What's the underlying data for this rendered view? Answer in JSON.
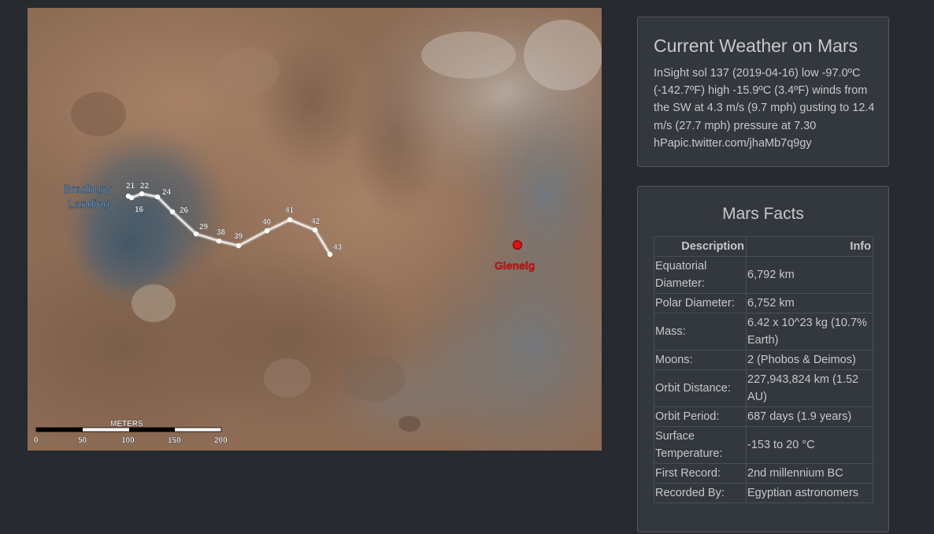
{
  "map": {
    "label_bradbury_1": "Bradbury",
    "label_bradbury_2": "Landing",
    "label_glenelg": "Glenelg",
    "scale_title": "METERS",
    "scale_ticks": [
      "0",
      "50",
      "100",
      "150",
      "200"
    ],
    "waypoints": [
      "21",
      "22",
      "16",
      "24",
      "26",
      "29",
      "38",
      "39",
      "40",
      "41",
      "42",
      "43"
    ]
  },
  "weather": {
    "title": "Current Weather on Mars",
    "text": "InSight sol 137 (2019-04-16) low -97.0ºC (-142.7ºF) high -15.9ºC (3.4ºF) winds from the SW at 4.3 m/s (9.7 mph) gusting to 12.4 m/s (27.7 mph) pressure at 7.30 hPapic.twitter.com/jhaMb7q9gy"
  },
  "facts": {
    "title": "Mars Facts",
    "headers": [
      "Description",
      "Info"
    ],
    "rows": [
      [
        "Equatorial Diameter:",
        "6,792 km"
      ],
      [
        "Polar Diameter:",
        "6,752 km"
      ],
      [
        "Mass:",
        "6.42 x 10^23 kg (10.7% Earth)"
      ],
      [
        "Moons:",
        "2 (Phobos & Deimos)"
      ],
      [
        "Orbit Distance:",
        "227,943,824 km (1.52 AU)"
      ],
      [
        "Orbit Period:",
        "687 days (1.9 years)"
      ],
      [
        "Surface Temperature:",
        "-153 to 20 °C"
      ],
      [
        "First Record:",
        "2nd millennium BC"
      ],
      [
        "Recorded By:",
        "Egyptian astronomers"
      ]
    ]
  },
  "colors": {
    "page_bg": "#272b30",
    "card_bg": "#32383e",
    "text": "#c8c8c8",
    "bradbury_label": "#5aa0e6",
    "glenelg_marker": "#e01010"
  }
}
